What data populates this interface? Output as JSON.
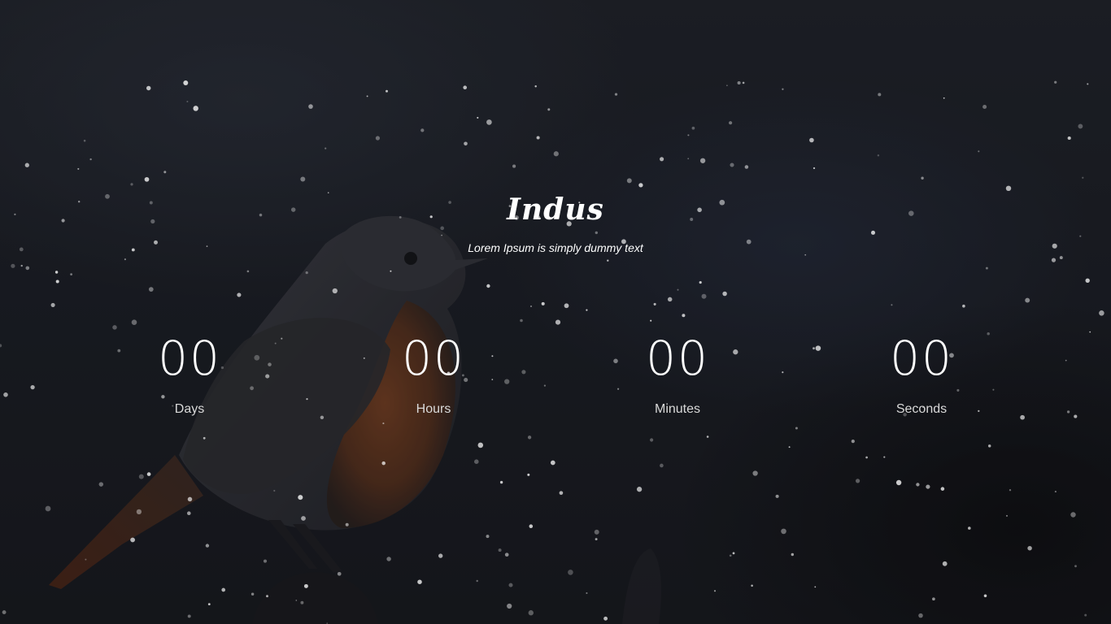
{
  "brand": {
    "title": "Indus",
    "tagline": "Lorem Ipsum is simply dummy text"
  },
  "countdown": {
    "units": [
      {
        "value": "00",
        "label": "Days"
      },
      {
        "value": "00",
        "label": "Hours"
      },
      {
        "value": "00",
        "label": "Minutes"
      },
      {
        "value": "00",
        "label": "Seconds"
      }
    ]
  },
  "colors": {
    "text": "#ffffff",
    "label": "#d9d9d9",
    "background": "#1a1d24",
    "bird_breast": "#8a4a22",
    "bird_body": "#3a3a40"
  },
  "background": {
    "subject": "bird-perched-photo",
    "effect": "snow-particles"
  }
}
